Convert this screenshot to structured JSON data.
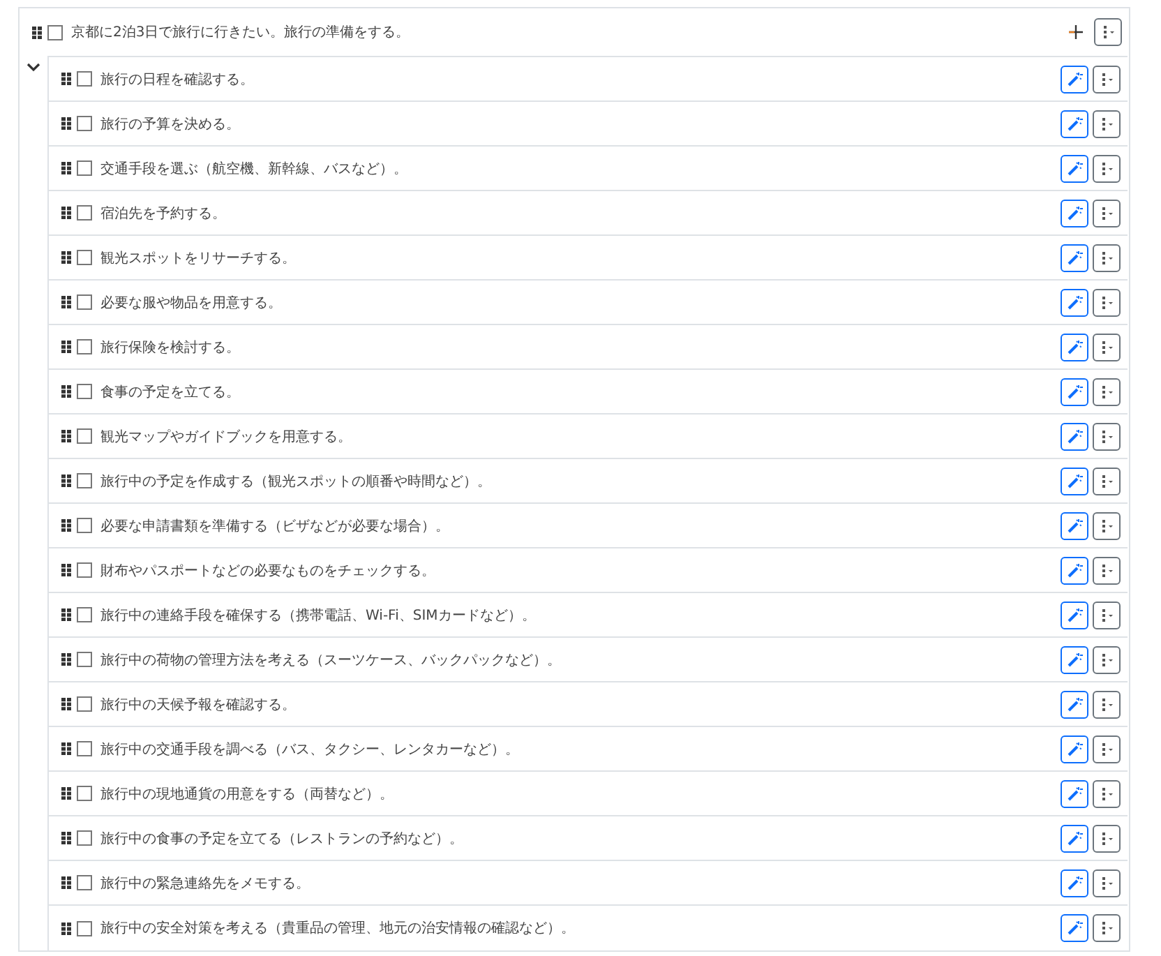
{
  "task": {
    "title": "京都に2泊3日で旅行に行きたい。旅行の準備をする。",
    "checked": false,
    "expanded": true,
    "children": [
      {
        "title": "旅行の日程を確認する。",
        "checked": false
      },
      {
        "title": "旅行の予算を決める。",
        "checked": false
      },
      {
        "title": "交通手段を選ぶ（航空機、新幹線、バスなど）。",
        "checked": false
      },
      {
        "title": "宿泊先を予約する。",
        "checked": false
      },
      {
        "title": "観光スポットをリサーチする。",
        "checked": false
      },
      {
        "title": "必要な服や物品を用意する。",
        "checked": false
      },
      {
        "title": "旅行保険を検討する。",
        "checked": false
      },
      {
        "title": "食事の予定を立てる。",
        "checked": false
      },
      {
        "title": "観光マップやガイドブックを用意する。",
        "checked": false
      },
      {
        "title": "旅行中の予定を作成する（観光スポットの順番や時間など）。",
        "checked": false
      },
      {
        "title": "必要な申請書類を準備する（ビザなどが必要な場合）。",
        "checked": false
      },
      {
        "title": "財布やパスポートなどの必要なものをチェックする。",
        "checked": false
      },
      {
        "title": "旅行中の連絡手段を確保する（携帯電話、Wi-Fi、SIMカードなど）。",
        "checked": false
      },
      {
        "title": "旅行中の荷物の管理方法を考える（スーツケース、バックパックなど）。",
        "checked": false
      },
      {
        "title": "旅行中の天候予報を確認する。",
        "checked": false
      },
      {
        "title": "旅行中の交通手段を調べる（バス、タクシー、レンタカーなど）。",
        "checked": false
      },
      {
        "title": "旅行中の現地通貨の用意をする（両替など）。",
        "checked": false
      },
      {
        "title": "旅行中の食事の予定を立てる（レストランの予約など）。",
        "checked": false
      },
      {
        "title": "旅行中の緊急連絡先をメモする。",
        "checked": false
      },
      {
        "title": "旅行中の安全対策を考える（貴重品の管理、地元の治安情報の確認など）。",
        "checked": false
      }
    ]
  }
}
